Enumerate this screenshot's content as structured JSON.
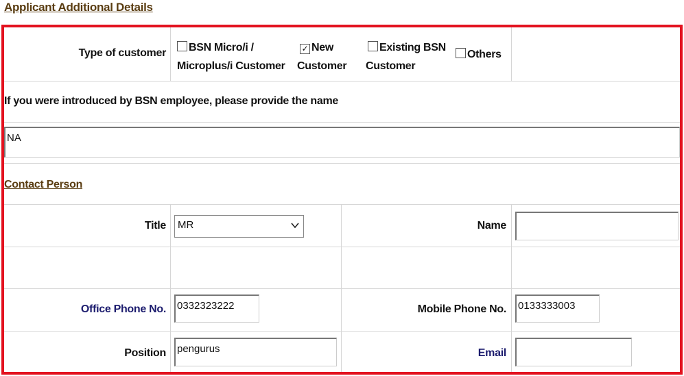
{
  "section_title": "Applicant Additional Details",
  "customer_type": {
    "label": "Type of customer",
    "options": [
      {
        "line1": "BSN Micro/i /",
        "line2": "Microplus/i Customer",
        "checked": false
      },
      {
        "line1": "New",
        "line2": "Customer",
        "checked": true
      },
      {
        "line1": "Existing BSN",
        "line2": "Customer",
        "checked": false
      },
      {
        "line1": "Others",
        "line2": "",
        "checked": false
      }
    ]
  },
  "introducer": {
    "label": "If you were introduced by BSN employee, please provide the name",
    "value": "NA"
  },
  "contact_section_title": "Contact Person",
  "contact": {
    "title_label": "Title",
    "title_value": "MR",
    "name_label": "Name",
    "name_value": "",
    "office_phone_label": "Office Phone No.",
    "office_phone_value": "0332323222",
    "mobile_phone_label": "Mobile Phone No.",
    "mobile_phone_value": "0133333003",
    "position_label": "Position",
    "position_value": "pengurus",
    "email_label": "Email",
    "email_value": ""
  },
  "colors": {
    "highlight_border": "#e3121f",
    "link": "#5a3d12",
    "label_blue": "#1c1c6e"
  },
  "checkmark_glyph": "✓"
}
